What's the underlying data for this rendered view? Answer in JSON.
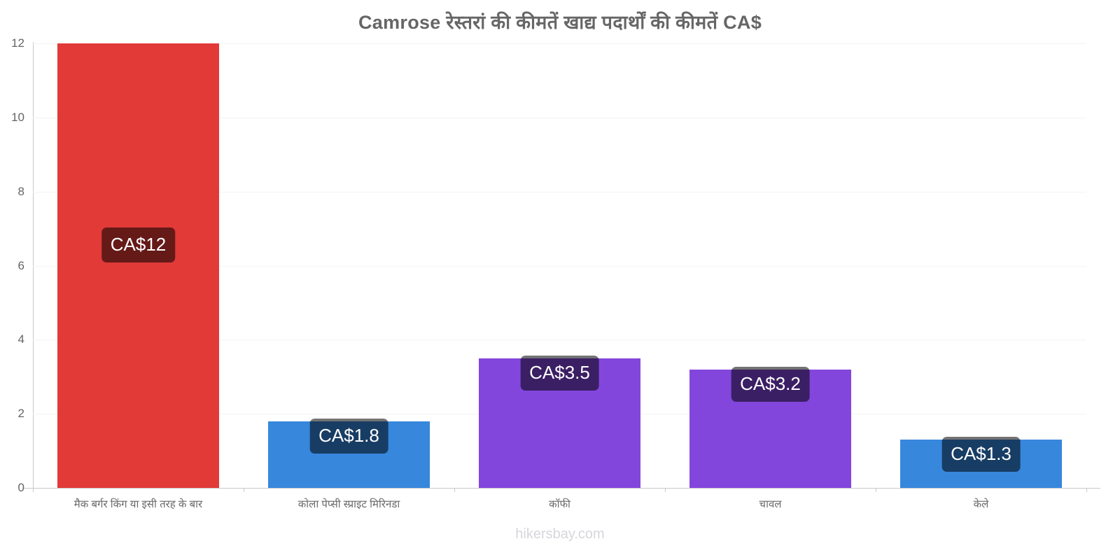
{
  "chart_data": {
    "type": "bar",
    "title": "Camrose रेस्तरां की कीमतें खाद्य पदार्थों की कीमतें CA$",
    "xlabel": "",
    "ylabel": "",
    "ylim": [
      0,
      12
    ],
    "yticks": [
      0,
      2,
      4,
      6,
      8,
      10,
      12
    ],
    "ytick_labels": [
      "0",
      "2",
      "4",
      "6",
      "8",
      "10",
      "12"
    ],
    "grid": true,
    "legend": "none",
    "currency": "CA$",
    "categories": [
      "मैक बर्गर किंग या इसी तरह के बार",
      "कोला पेप्सी स्प्राइट मिरिनडा",
      "कॉफी",
      "चावल",
      "केले"
    ],
    "values": [
      12,
      1.8,
      3.5,
      3.2,
      1.3
    ],
    "value_labels": [
      "CA$12",
      "CA$1.8",
      "CA$3.5",
      "CA$3.2",
      "CA$1.3"
    ],
    "bar_colors": [
      "#e13a37",
      "#3787dd",
      "#8346dd",
      "#8346dd",
      "#3787dd"
    ]
  },
  "footer": {
    "credit": "hikersbay.com"
  },
  "colors": {
    "title": "#666666",
    "axis": "#c9c9c9",
    "grid": "#f4f4f4",
    "tick_text": "#656565",
    "label_badge_bg": "rgba(0,0,0,0.55)",
    "label_badge_text": "#ffffff",
    "footer_text": "#d6d6dc",
    "red": "#e13a37",
    "blue": "#3787dd",
    "purple": "#8346dd"
  }
}
